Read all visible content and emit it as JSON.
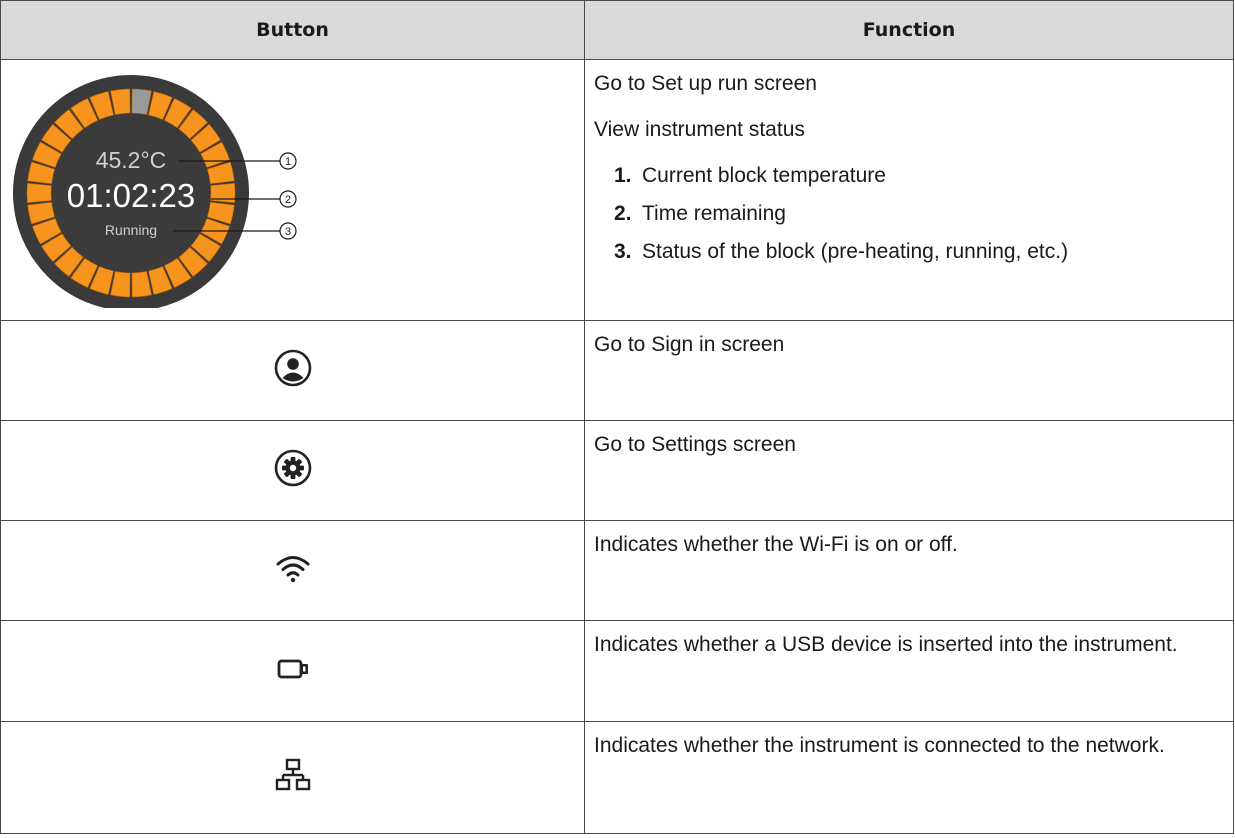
{
  "header": {
    "button": "Button",
    "function": "Function"
  },
  "rows": [
    {
      "lines": [
        "Go to Set up run screen",
        "View instrument status"
      ],
      "steps": [
        {
          "num": "1.",
          "text": "Current block temperature"
        },
        {
          "num": "2.",
          "text": "Time remaining"
        },
        {
          "num": "3.",
          "text": "Status of the block (pre-heating, running, etc.)"
        }
      ],
      "dial": {
        "temperature": "45.2°C",
        "time": "01:02:23",
        "status": "Running",
        "callouts": [
          "1",
          "2",
          "3"
        ],
        "accent": "#f7941d",
        "ring": "#3a3a3a"
      }
    },
    {
      "icon": "user-icon",
      "text": "Go to Sign in screen"
    },
    {
      "icon": "gear-icon",
      "text": "Go to Settings screen"
    },
    {
      "icon": "wifi-icon",
      "text": "Indicates whether the Wi-Fi is on or off."
    },
    {
      "icon": "usb-icon",
      "text": "Indicates whether a USB device is inserted into the instrument."
    },
    {
      "icon": "network-icon",
      "text": "Indicates whether the instrument is connected to the network."
    }
  ]
}
